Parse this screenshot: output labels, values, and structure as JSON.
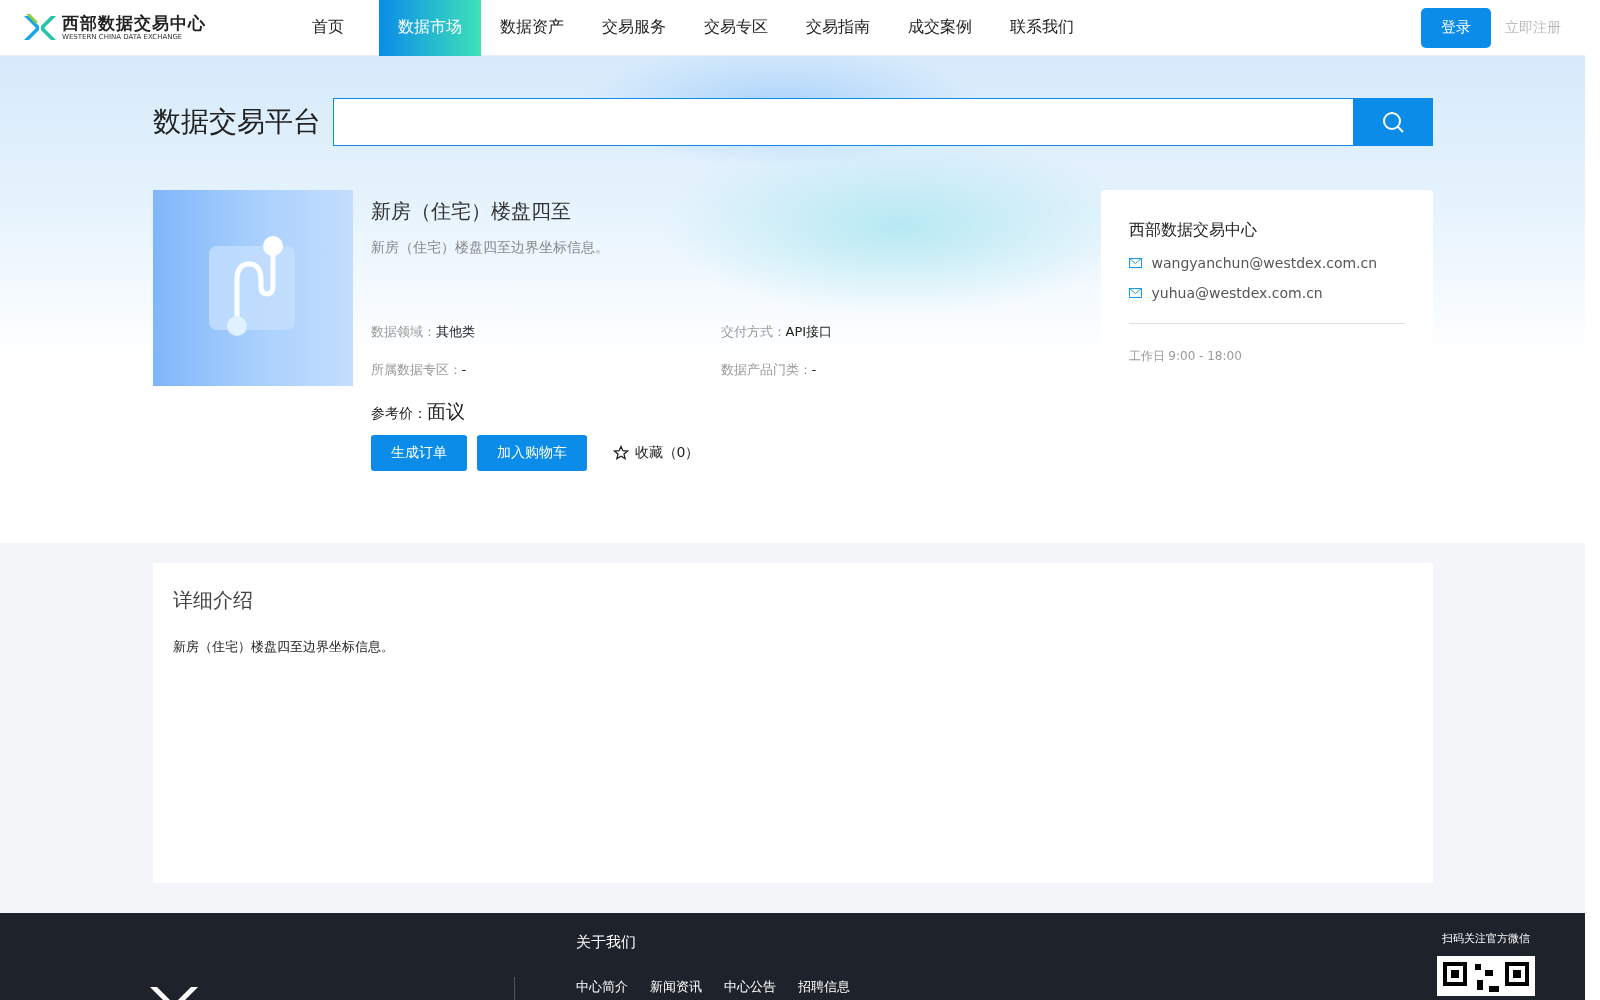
{
  "header": {
    "logo_title": "西部数据交易中心",
    "logo_subtitle": "WESTERN CHINA DATA EXCHANGE",
    "nav": [
      {
        "label": "首页",
        "selected": false
      },
      {
        "label": "数据市场",
        "selected": true
      },
      {
        "label": "数据资产",
        "selected": false
      },
      {
        "label": "交易服务",
        "selected": false
      },
      {
        "label": "交易专区",
        "selected": false
      },
      {
        "label": "交易指南",
        "selected": false
      },
      {
        "label": "成交案例",
        "selected": false
      },
      {
        "label": "联系我们",
        "selected": false
      }
    ],
    "login": "登录",
    "register": "立即注册"
  },
  "search": {
    "label": "数据交易平台"
  },
  "product": {
    "title": "新房（住宅）楼盘四至",
    "summary": "新房（住宅）楼盘四至边界坐标信息。",
    "fields": [
      {
        "label": "数据领域：",
        "value": "其他类"
      },
      {
        "label": "交付方式：",
        "value": "API接口"
      },
      {
        "label": "所属数据专区：",
        "value": "-"
      },
      {
        "label": "数据产品门类：",
        "value": "-"
      }
    ],
    "price_label": "参考价：",
    "price": "面议",
    "buttons": [
      "生成订单",
      "加入购物车"
    ],
    "favorite": "收藏（0）"
  },
  "contact": {
    "name": "西部数据交易中心",
    "emails": [
      "wangyanchun@westdex.com.cn",
      "yuhua@westdex.com.cn"
    ],
    "hours_label": "工作日",
    "hours": "9:00 - 18:00"
  },
  "detail": {
    "title": "详细介绍",
    "text": "新房（住宅）楼盘四至边界坐标信息。"
  },
  "footer": {
    "about_title": "关于我们",
    "links": [
      "中心简介",
      "新闻资讯",
      "中心公告",
      "招聘信息"
    ],
    "wechat_label": "扫码关注官方微信"
  }
}
